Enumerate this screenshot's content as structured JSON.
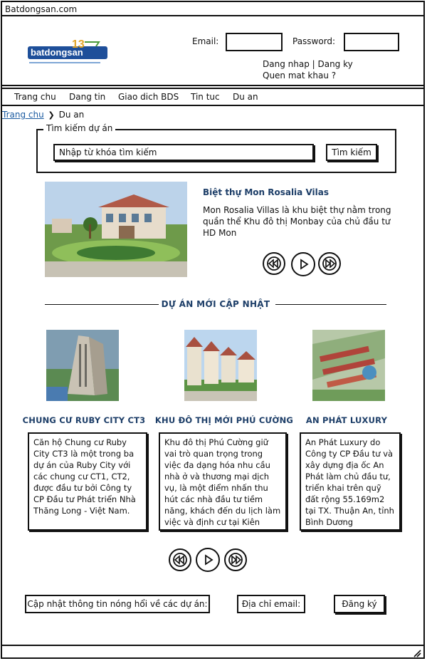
{
  "window": {
    "title": "Batdongsan.com"
  },
  "header": {
    "logo_text": "batdongsan",
    "logo_badge": "13",
    "email_label": "Email:",
    "password_label": "Password:",
    "login_register": "Dang nhap | Dang ky",
    "forgot_password": "Quen mat khau ?"
  },
  "nav": {
    "items": [
      "Trang chu",
      "Dang tin",
      "Giao dich BDS",
      "Tin tuc",
      "Du an"
    ]
  },
  "breadcrumb": {
    "home": "Trang chu",
    "current": "Du an"
  },
  "search": {
    "legend": "Tìm kiếm dự án",
    "placeholder": "Nhập từ khóa tìm kiếm",
    "button": "Tìm kiếm"
  },
  "featured": {
    "title": "Biệt thự Mon Rosalia Vilas",
    "description": "Mon Rosalia Villas là khu biệt thự nằm trong quần thể Khu đô thị Monbay của chủ đầu tư HD Mon"
  },
  "section": {
    "title": "DỰ ÁN MỚI CẬP NHẬT"
  },
  "projects": [
    {
      "title": "CHUNG CƯ RUBY CITY CT3",
      "description": "Căn hộ Chung cư Ruby City CT3 là một trong ba dự án của Ruby City với các chung cư CT1, CT2, được đầu tư bởi Công ty CP Đầu tư Phát triển Nhà Thăng Long - Việt Nam."
    },
    {
      "title": "KHU ĐÔ THỊ MỚI PHÚ CƯỜNG",
      "description": "Khu đô thị Phú Cường giữ vai trò quan trọng trong việc đa dạng hóa nhu cầu nhà ở và thương mại dịch vụ, là một điểm nhấn thu hút các nhà đầu tư tiềm năng, khách đến du lịch làm việc và định cư tại Kiên Giang"
    },
    {
      "title": "AN PHÁT LUXURY",
      "description": "An Phát Luxury do Công ty CP Đầu tư và xây dựng địa ốc An Phát làm chủ đầu tư, triển khai trên quỹ đất rộng 55.169m2 tại TX. Thuận An, tỉnh Bình Dương"
    }
  ],
  "subscribe": {
    "label": "Cập nhật thông tin nóng hổi về các dự án:",
    "email_label": "Địa chỉ email:",
    "button": "Đăng ký"
  },
  "icons": [
    "rewind-icon",
    "play-icon",
    "fast-forward-icon",
    "resize-grip-icon"
  ],
  "colors": {
    "accent": "#1d3e68",
    "link": "#1a5aa0"
  }
}
